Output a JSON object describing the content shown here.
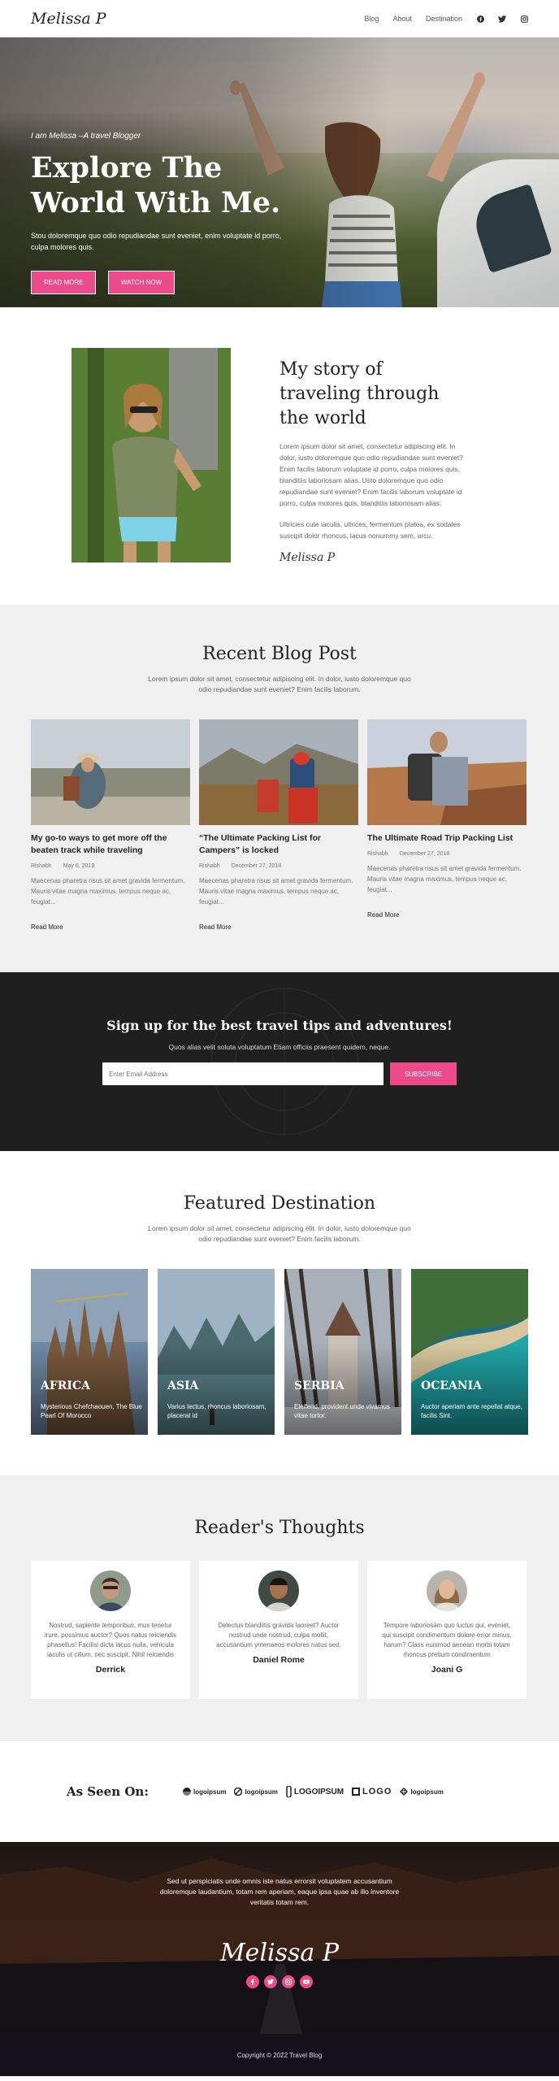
{
  "header": {
    "logo": "Melissa P",
    "nav": [
      "Blog",
      "About",
      "Destination"
    ],
    "social_icons": [
      "facebook-icon",
      "twitter-icon",
      "instagram-icon"
    ]
  },
  "hero": {
    "kicker": "I am Melissa –A travel Blogger",
    "title_line1": "Explore The",
    "title_line2": "World With Me.",
    "text": "Stou doloremque quo odio repudiandae sunt eveniet, enim voluptate id porro, culpa molores quis.",
    "btn_read": "READ MORE",
    "btn_watch": "WATCH NOW"
  },
  "story": {
    "title": "My story of traveling through the world",
    "p1": "Lorem ipsum dolor sit amet, consectetur adipiscing elit. In dolor, iusto doloremque quo odio repudiandae sunt eveniet? Enim facilis laborum voluptate id porro, culpa molores quis, blanditiis laboriosam alias. Usto doloremque quo odio repudiandae sunt eveniet? Enim facilis laborum voluptate id porro, culpa molores quis, blanditiis laboriosam alias.",
    "p2": "Ultricies cute iaculis, ultrices, fermentum platea, ex sodales suscipit dolor rhoncus, lacus nonummy sem, arcu.",
    "signature": "Melissa P"
  },
  "blog": {
    "title": "Recent Blog Post",
    "subtitle": "Lorem ipsum dolor sit amet, consectetur adipiscing elit. In dolor, iusto doloremque quo odio repudiandae sunt eveniet? Enim facilis laborum.",
    "posts": [
      {
        "title": "My go-to ways to get more off the beaten track while traveling",
        "author": "Rishabh",
        "date": "May 6, 2019",
        "excerpt": "Maecenas pharetra risus sit amet gravida fermentum. Mauris vitae magna maximus, tempus neque ac, feugiat...",
        "more": "Read More"
      },
      {
        "title": "“The Ultimate Packing List for Campers” is locked",
        "author": "Rishabh",
        "date": "December 27, 2018",
        "excerpt": "Maecenas pharetra risus sit amet gravida fermentum. Mauris vitae magna maximus, tempus neque ac, feugiat...",
        "more": "Read More"
      },
      {
        "title": "The Ultimate Road Trip Packing List",
        "author": "Rishabh",
        "date": "December 27, 2018",
        "excerpt": "Maecenas pharetra risus sit amet gravida fermentum. Mauris vitae magna maximus, tempus neque ac, feugiat...",
        "more": "Read More"
      }
    ]
  },
  "signup": {
    "title": "Sign up for the best travel tips and adventures!",
    "text": "Quos alias velit soluta voluptatum Etiam officiis praesent quidem, neque.",
    "placeholder": "Enter Email Address",
    "button": "SUBSCRIBE"
  },
  "destinations": {
    "title": "Featured Destination",
    "subtitle": "Lorem ipsum dolor sit amet, consectetur adipiscing elit. In dolor, iusto doloremque quo odio repudiandae sunt eveniet? Enim facilis laborum.",
    "items": [
      {
        "name": "AFRICA",
        "text": "Mysterious Chefchaouen, The Blue Pearl Of Morocco"
      },
      {
        "name": "ASIA",
        "text": "Varius lectus, rhoncus laboriosam, placerat id"
      },
      {
        "name": "SERBIA",
        "text": "Eleifend, provident unde vivamus vitae tortor."
      },
      {
        "name": "OCEANIA",
        "text": "Auctor aperiam ante repellat atque, facilis Sint."
      }
    ]
  },
  "thoughts": {
    "title": "Reader's Thoughts",
    "items": [
      {
        "text": "Nostrud, sapiente temporibus, mus tenetur irure, possimus auctor? Quos natus reiciendis phasellus! Facilisi dicta lacus nulla, vehicula iaculis ut cillum, nec suscipit. Nihil reiciendis",
        "name": "Derrick"
      },
      {
        "text": "Delectus blandiitis gravida laoreet? Auctor nostrud unde nostrud, culpa mollit, accusantium ymenaeos molores natus sed.",
        "name": "Daniel Rome"
      },
      {
        "text": "Tempore laboriosam quo luctus qui, eveniet, qui suscipit condimentum dolore error minus, harum? Class euismod aenean morbi totam rhoncus pretium condimentum",
        "name": "Joani G"
      }
    ]
  },
  "seen": {
    "label": "As Seen On:",
    "logos": [
      "logoipsum",
      "logoipsum",
      "LOGOIPSUM",
      "LOGO",
      "logoipsum"
    ]
  },
  "footer": {
    "text": "Sed ut perspiciatis unde omnis iste natus errorsit voluptatem accusantium doloremque laudantium, totam rem aperiam, eaque ipsa quae ab illo inventore veritatis totam rem.",
    "logo": "Melissa P",
    "social_icons": [
      "facebook-icon",
      "twitter-icon",
      "instagram-icon",
      "youtube-icon"
    ],
    "copyright": "Copyright © 2022 Travel Blog"
  },
  "colors": {
    "accent": "#ec4a8a",
    "dark": "#1f1f1f",
    "light_bg": "#f0f0f0"
  }
}
